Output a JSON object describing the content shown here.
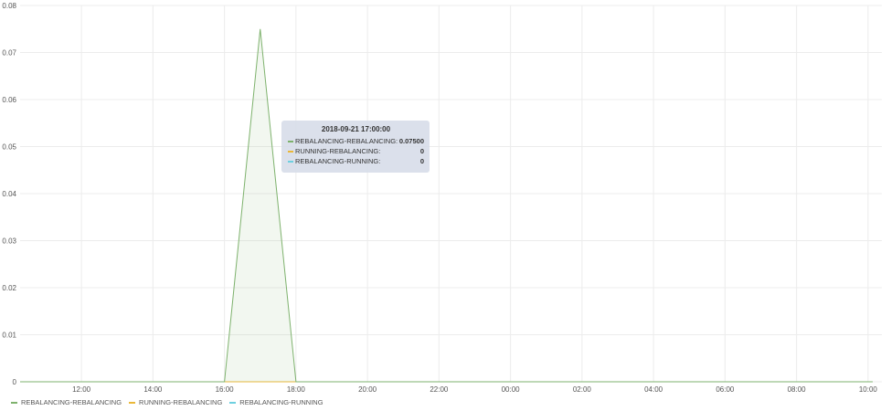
{
  "chart_data": {
    "type": "area",
    "x": [
      "11:00",
      "12:00",
      "13:00",
      "14:00",
      "15:00",
      "16:00",
      "17:00",
      "18:00",
      "19:00",
      "20:00",
      "21:00",
      "22:00",
      "23:00",
      "00:00",
      "01:00",
      "02:00",
      "03:00",
      "04:00",
      "05:00",
      "06:00",
      "07:00",
      "08:00",
      "09:00",
      "10:00"
    ],
    "x_ticks": [
      "12:00",
      "14:00",
      "16:00",
      "18:00",
      "20:00",
      "22:00",
      "00:00",
      "02:00",
      "04:00",
      "06:00",
      "08:00",
      "10:00"
    ],
    "y_ticks": [
      "0",
      "0.01",
      "0.02",
      "0.03",
      "0.04",
      "0.05",
      "0.06",
      "0.07",
      "0.08"
    ],
    "ylim": [
      0,
      0.08
    ],
    "grid": true,
    "legend": "bottom-left",
    "series": [
      {
        "name": "REBALANCING-REBALANCING",
        "color": "#7eb26d",
        "values": [
          0,
          0,
          0,
          0,
          0,
          0,
          0.075,
          0,
          0,
          0,
          0,
          0,
          0,
          0,
          0,
          0,
          0,
          0,
          0,
          0,
          0,
          0,
          0,
          0
        ]
      },
      {
        "name": "RUNNING-REBALANCING",
        "color": "#eab839",
        "values": [
          0,
          0,
          0,
          0,
          0,
          0,
          0,
          0,
          0,
          0,
          0,
          0,
          0,
          0,
          0,
          0,
          0,
          0,
          0,
          0,
          0,
          0,
          0,
          0
        ]
      },
      {
        "name": "REBALANCING-RUNNING",
        "color": "#6ed0e0",
        "values": [
          0,
          0,
          0,
          0,
          0,
          0,
          0,
          0,
          0,
          0,
          0,
          0,
          0,
          0,
          0,
          0,
          0,
          0,
          0,
          0,
          0,
          0,
          0,
          0
        ]
      }
    ],
    "tooltip": {
      "title": "2018-09-21 17:00:00",
      "rows": [
        {
          "name": "REBALANCING-REBALANCING:",
          "value": "0.07500",
          "color": "#7eb26d"
        },
        {
          "name": "RUNNING-REBALANCING:",
          "value": "0",
          "color": "#eab839"
        },
        {
          "name": "REBALANCING-RUNNING:",
          "value": "0",
          "color": "#6ed0e0"
        }
      ]
    }
  }
}
